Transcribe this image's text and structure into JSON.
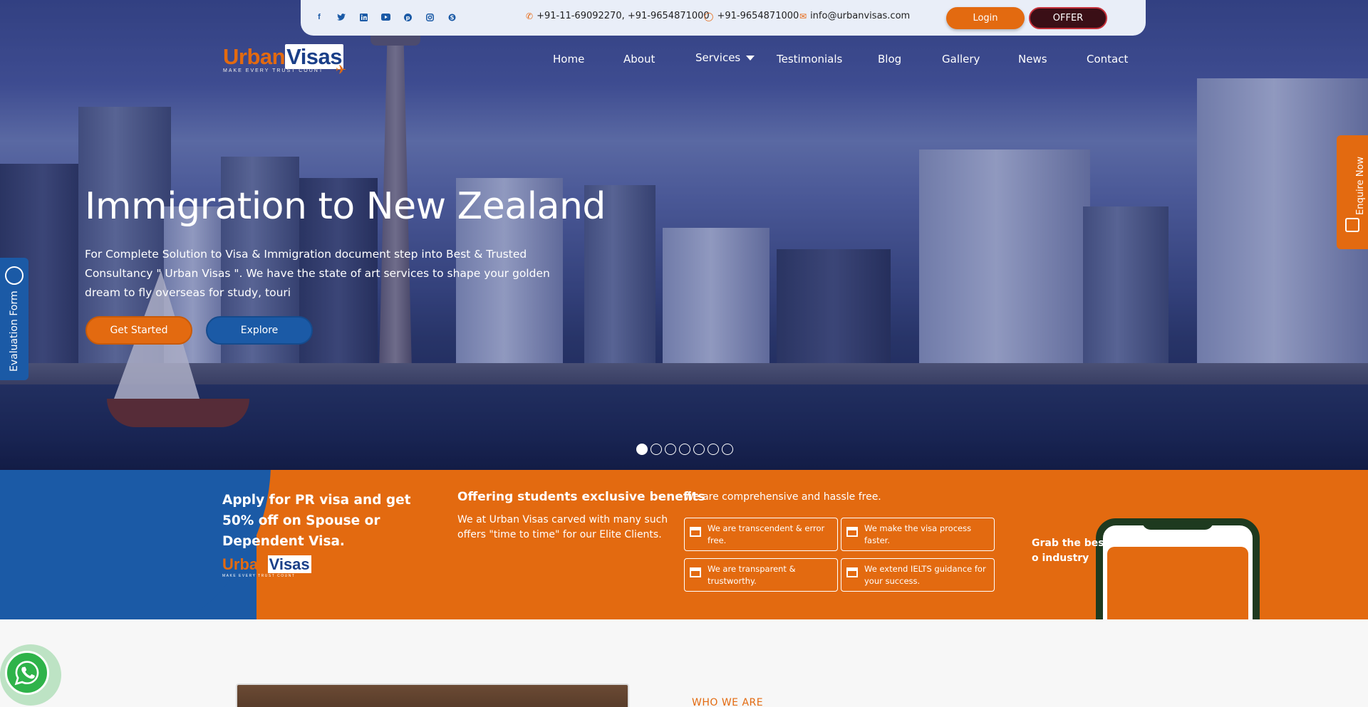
{
  "topbar": {
    "social_icons": [
      "facebook-icon",
      "twitter-icon",
      "linkedin-icon",
      "youtube-icon",
      "pinterest-icon",
      "instagram-icon",
      "skype-icon"
    ],
    "phone": "+91-11-69092270, +91-9654871000",
    "whatsapp": "+91-9654871000",
    "email": "info@urbanvisas.com",
    "login_label": "Login",
    "offer_label": "OFFER"
  },
  "logo": {
    "part1": "Urban",
    "part2": "Visas",
    "tagline": "MAKE EVERY TRUST COUNT"
  },
  "nav": {
    "items": [
      "Home",
      "About",
      "Services",
      "Testimonials",
      "Blog",
      "Gallery",
      "News",
      "Contact"
    ]
  },
  "hero": {
    "title": "Immigration to New Zealand",
    "description": "For Complete Solution to Visa & Immigration document step into Best & Trusted Consultancy \" Urban Visas \". We have the state of art services to shape your golden dream to fly overseas for study, touri",
    "get_started_label": "Get Started",
    "explore_label": "Explore",
    "slide_count": 7,
    "active_slide": 1
  },
  "side_tabs": {
    "evaluation": "Evaluation Form",
    "enquire": "Enquire Now"
  },
  "band": {
    "pr_title": "Apply for PR visa and get 50% off on Spouse or Dependent Visa.",
    "offer_title": "Offering students exclusive benefits",
    "offer_desc": "We at Urban Visas carved with many such offers \"time to time\" for our Elite Clients.",
    "hassle_title": "We are comprehensive and hassle free.",
    "features": [
      "We are transcendent & error free.",
      "We make the visa process faster.",
      "We are transparent & trustworthy.",
      "We extend IELTS guidance for your success."
    ],
    "grab_text": "Grab the best o industry"
  },
  "below": {
    "who_label": "WHO WE ARE"
  },
  "colors": {
    "orange": "#e36a10",
    "blue": "#1b5aa6",
    "offer_dark": "#3a0f16",
    "whatsapp": "#2fb34a"
  }
}
